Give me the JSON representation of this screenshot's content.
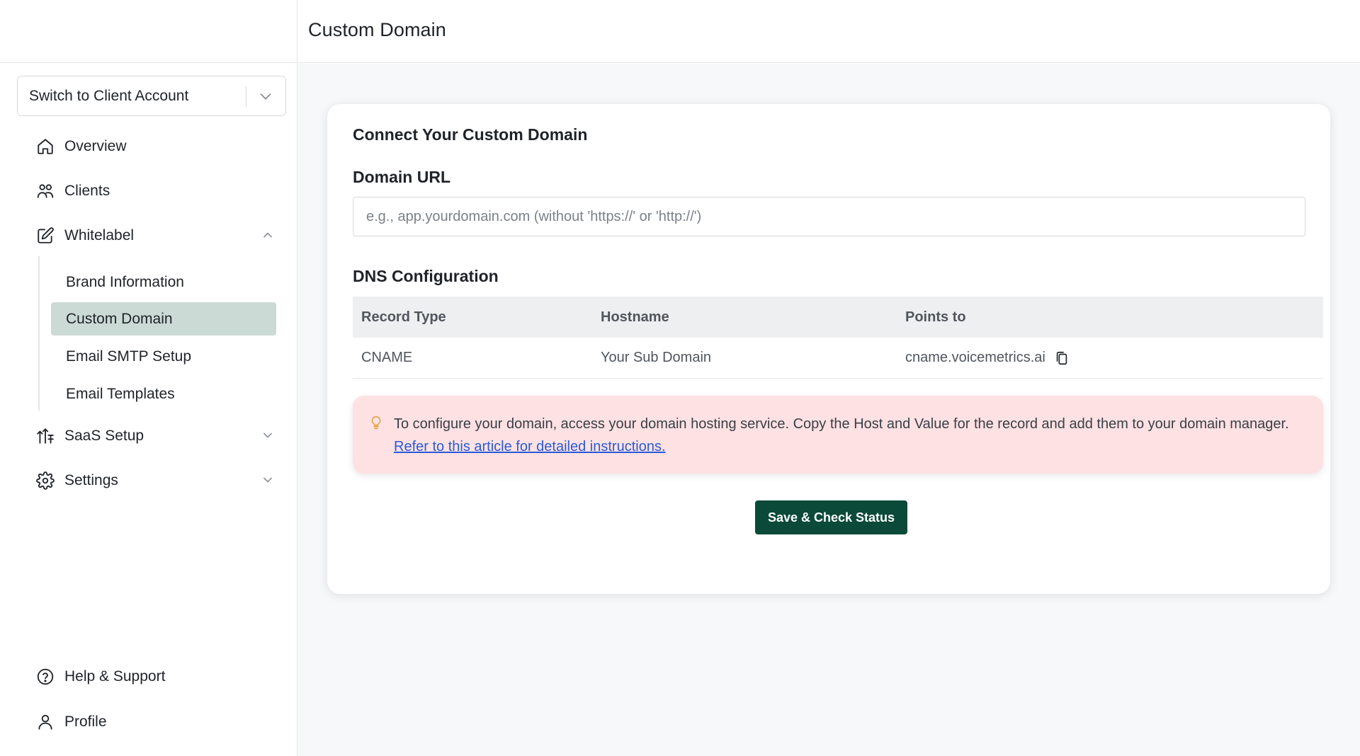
{
  "header": {
    "title": "Custom Domain"
  },
  "sidebar": {
    "switcher": {
      "label": "Switch to Client Account"
    },
    "nav": {
      "overview": "Overview",
      "clients": "Clients",
      "whitelabel": "Whitelabel",
      "saas": "SaaS Setup",
      "settings": "Settings",
      "help": "Help & Support",
      "profile": "Profile"
    },
    "whitelabel_items": [
      "Brand Information",
      "Custom Domain",
      "Email SMTP Setup",
      "Email Templates"
    ],
    "active_item": "Custom Domain"
  },
  "card": {
    "title": "Connect Your Custom Domain",
    "domain_label": "Domain URL",
    "domain_value": "",
    "domain_placeholder": "e.g., app.yourdomain.com (without 'https://' or 'http://')",
    "dns_title": "DNS Configuration",
    "table": {
      "headers": [
        "Record Type",
        "Hostname",
        "Points to"
      ],
      "rows": [
        {
          "type": "CNAME",
          "hostname": "Your Sub Domain",
          "points_to": "cname.voicemetrics.ai"
        }
      ]
    },
    "alert": {
      "text": "To configure your domain, access your domain hosting service. Copy the Host and Value for the record and add them to your domain manager.",
      "link": "Refer to this article for detailed instructions."
    },
    "button": "Save & Check Status"
  },
  "colors": {
    "accent": "#0b4a38",
    "active_bg": "#ccdad5",
    "alert_bg": "#fde1e3",
    "link": "#2a5bd7"
  }
}
